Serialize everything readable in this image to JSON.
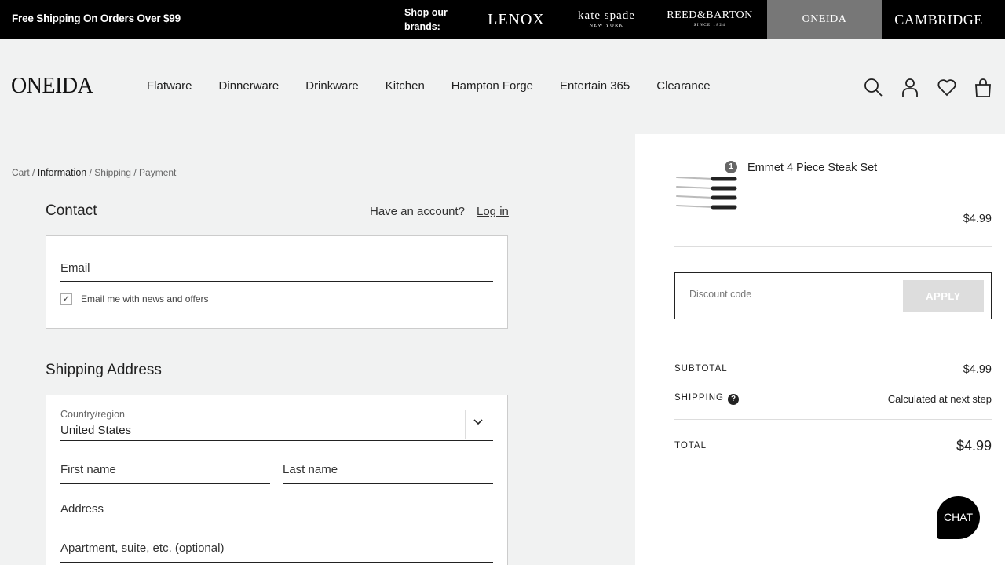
{
  "topbar": {
    "promo": "Free Shipping On Orders Over $99",
    "shop_brands": "Shop our brands:",
    "brands": {
      "lenox": "LENOX",
      "kate_spade": "kate spade",
      "kate_spade_sub": "NEW YORK",
      "reed_barton": "REED&BARTON",
      "reed_barton_sub": "SINCE 1824",
      "oneida": "ONEIDA",
      "cambridge": "CAMBRIDGE"
    }
  },
  "header": {
    "logo": "ONEIDA",
    "nav": [
      "Flatware",
      "Dinnerware",
      "Drinkware",
      "Kitchen",
      "Hampton Forge",
      "Entertain 365",
      "Clearance"
    ],
    "icons": [
      "search-icon",
      "account-icon",
      "wishlist-heart-icon",
      "shopping-bag-icon"
    ]
  },
  "breadcrumb": {
    "cart": "Cart",
    "information": "Information",
    "shipping": "Shipping",
    "payment": "Payment",
    "sep": "/"
  },
  "contact": {
    "title": "Contact",
    "have_account": "Have an account?",
    "login": "Log in",
    "email_placeholder": "Email",
    "newsletter_label": "Email me with news and offers",
    "newsletter_checked": true
  },
  "shipping_address": {
    "title": "Shipping Address",
    "country_label": "Country/region",
    "country_value": "United States",
    "first_name_placeholder": "First name",
    "last_name_placeholder": "Last name",
    "address_placeholder": "Address",
    "apartment_placeholder": "Apartment, suite, etc. (optional)"
  },
  "order_summary": {
    "product_name": "Emmet 4 Piece Steak Set",
    "product_qty": "1",
    "product_price": "$4.99",
    "discount_placeholder": "Discount code",
    "apply_label": "APPLY",
    "subtotal_label": "SUBTOTAL",
    "subtotal_value": "$4.99",
    "shipping_label": "SHIPPING",
    "shipping_value": "Calculated at next step",
    "total_label": "TOTAL",
    "total_value": "$4.99"
  },
  "chat": {
    "label": "CHAT"
  },
  "colors": {
    "topbar_bg": "#000000",
    "header_bg": "#f1f2f2",
    "oneida_tab_bg": "#777777",
    "apply_btn_bg": "#dddddd"
  }
}
